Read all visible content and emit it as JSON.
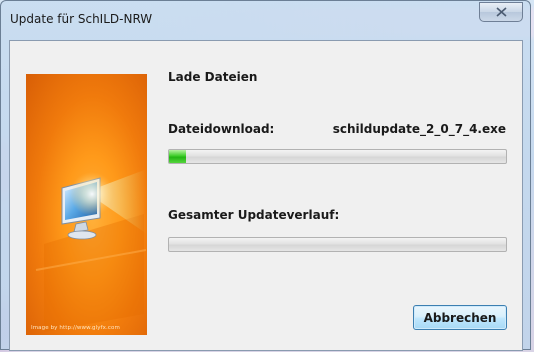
{
  "window": {
    "title": "Update für SchILD-NRW",
    "close_icon": "close-icon"
  },
  "side_image": {
    "description_icon": "monitor-icon",
    "credit": "Image by http://www.glyfx.com",
    "colors": {
      "primary": "#ff9a1a"
    }
  },
  "main": {
    "status_label": "Lade Dateien",
    "file_download_label": "Dateidownload:",
    "file_name": "schildupdate_2_0_7_4.exe",
    "file_progress_percent": 5,
    "overall_label": "Gesamter Updateverlauf:",
    "overall_progress_percent": 0
  },
  "buttons": {
    "abort_label": "Abbrechen"
  },
  "colors": {
    "progress_fill": "#3fce2a",
    "button_border": "#3c7fb1"
  }
}
